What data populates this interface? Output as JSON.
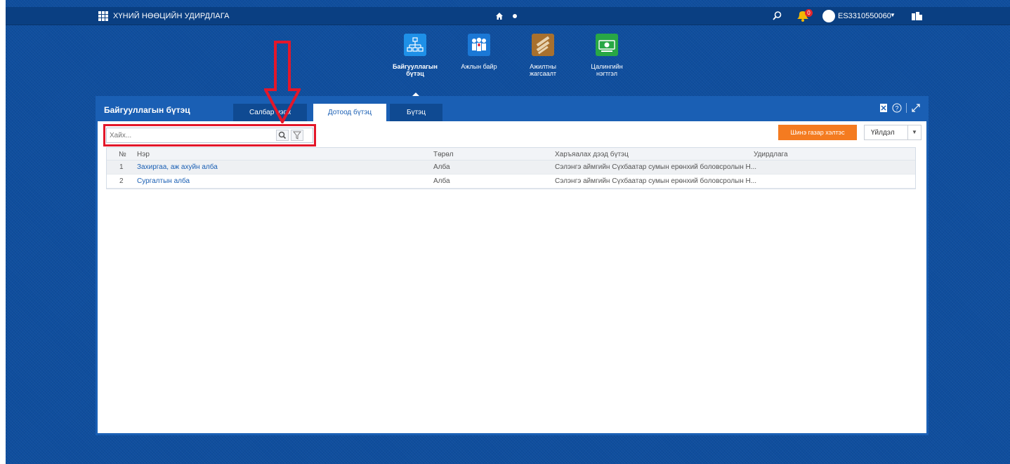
{
  "shell": {
    "app_title": "ХҮНИЙ НӨӨЦИЙН УДИРДЛАГА",
    "notification_count": "0",
    "username": "ES3310550060",
    "icons": [
      "apps-grid-icon",
      "home-icon",
      "search-icon",
      "notification-icon",
      "user-avatar-icon",
      "cards-icon"
    ]
  },
  "launchpad": {
    "tiles": [
      {
        "label": "Байгууллагын бүтэц",
        "icon": "org-chart-icon",
        "color": "#1e90e8",
        "active": true
      },
      {
        "label": "Ажлын байр",
        "icon": "people-icon",
        "color": "#1b78d6",
        "active": false
      },
      {
        "label": "Ажилтны жагсаалт",
        "icon": "employee-list-icon",
        "color": "#a8702e",
        "active": false
      },
      {
        "label": "Цалингийн нэгтгэл",
        "icon": "money-icon",
        "color": "#28a745",
        "active": false
      }
    ]
  },
  "panel": {
    "title": "Байгууллагын бүтэц",
    "tabs": [
      {
        "label": "Салбар нэгж",
        "active": false
      },
      {
        "label": "Дотоод бүтэц",
        "active": true
      },
      {
        "label": "Бүтэц",
        "active": false
      }
    ],
    "search_placeholder": "Хайх...",
    "add_button": "Шинэ газар хэлтэс",
    "actions_label": "Үйлдэл"
  },
  "table": {
    "columns": [
      "№",
      "Нэр",
      "Төрөл",
      "Харъяалах дээд бүтэц",
      "Удирдлага"
    ],
    "rows": [
      {
        "no": "1",
        "name": "Захиргаа, аж ахуйн алба",
        "type": "Алба",
        "parent": "Сэлэнгэ аймгийн Сүхбаатар сумын ерөнхий боловсролын Н...",
        "manager": ""
      },
      {
        "no": "2",
        "name": "Сургалтын алба",
        "type": "Алба",
        "parent": "Сэлэнгэ аймгийн Сүхбаатар сумын ерөнхий боловсролын Н...",
        "manager": ""
      }
    ]
  },
  "colors": {
    "background": "#0f4e9e",
    "panel_header": "#1a5fb4",
    "accent_orange": "#f47b20",
    "annotation_red": "#e3172a"
  }
}
